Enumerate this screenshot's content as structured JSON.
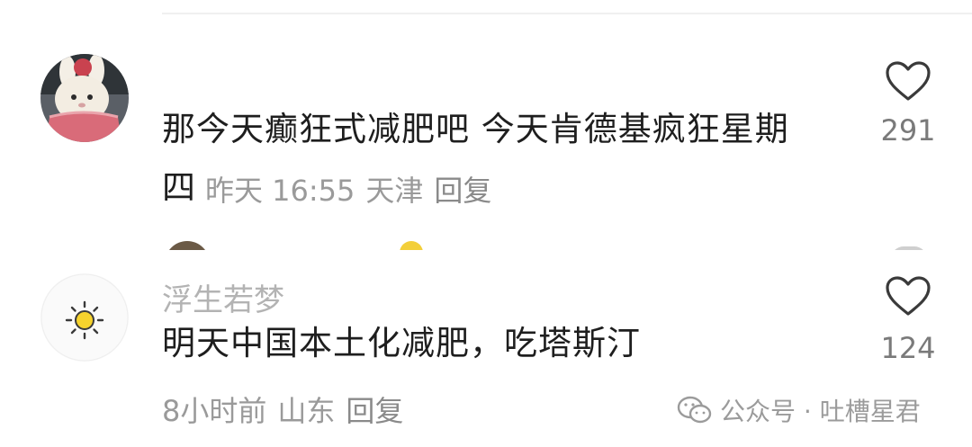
{
  "comments": [
    {
      "username": "",
      "text": "那今天癫狂式减肥吧 今天肯德基疯狂星期",
      "text_tail": "四",
      "time": "昨天 16:55",
      "location": "天津",
      "reply": "回复",
      "likes": "291",
      "avatar": "bunny-plush-icon"
    },
    {
      "username": "浮生若梦",
      "text": "明天中国本土化减肥，吃塔斯汀",
      "time": "8小时前",
      "location": "山东",
      "reply": "回复",
      "likes": "124",
      "avatar": "sun-icon"
    }
  ],
  "watermark": {
    "text": "公众号 · 吐槽星君",
    "icon": "wechat-icon"
  },
  "colors": {
    "text": "#1e1e1e",
    "meta": "#9a9a9a",
    "username": "#b3b3b3",
    "like": "#7a7a7a",
    "avatar_pink": "#d96b79"
  }
}
